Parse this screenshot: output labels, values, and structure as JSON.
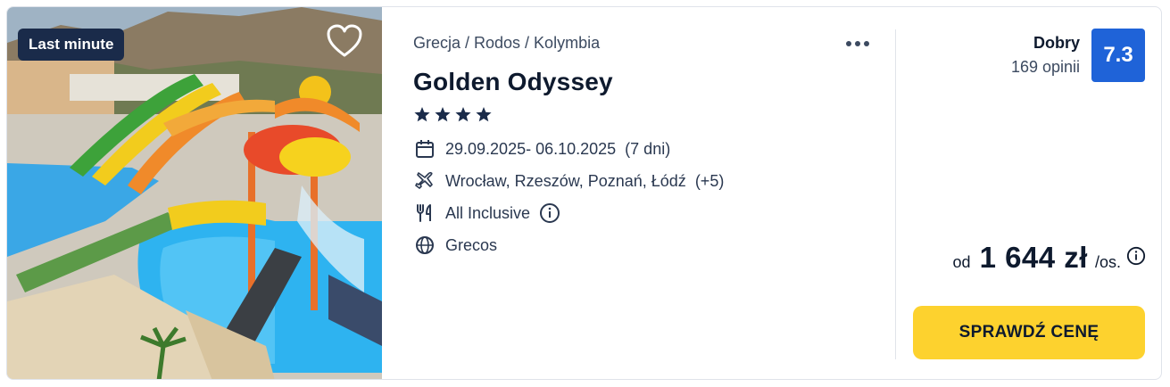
{
  "offer": {
    "badge": "Last minute",
    "breadcrumb": "Grecja / Rodos / Kolymbia",
    "hotel_name": "Golden Odyssey",
    "stars": 4,
    "dates": "29.09.2025- 06.10.2025",
    "duration": "(7 dni)",
    "departures": "Wrocław, Rzeszów, Poznań, Łódź",
    "departures_extra": "(+5)",
    "board": "All Inclusive",
    "operator": "Grecos"
  },
  "rating": {
    "label": "Dobry",
    "count": "169 opinii",
    "score": "7.3"
  },
  "price": {
    "prefix": "od",
    "amount": "1 644 zł",
    "suffix": "/os."
  },
  "cta_label": "SPRAWDŹ CENĘ",
  "icons": {
    "favorite": "heart-outline-icon",
    "more": "more-dots-icon",
    "calendar": "calendar-icon",
    "plane": "plane-icon",
    "food": "fork-knife-icon",
    "globe": "globe-icon",
    "info": "info-circle-icon"
  },
  "colors": {
    "badge_bg": "#1a2b4a",
    "score_bg": "#1f63d8",
    "cta_bg": "#fdd22e",
    "text_dark": "#0e1a2e"
  }
}
